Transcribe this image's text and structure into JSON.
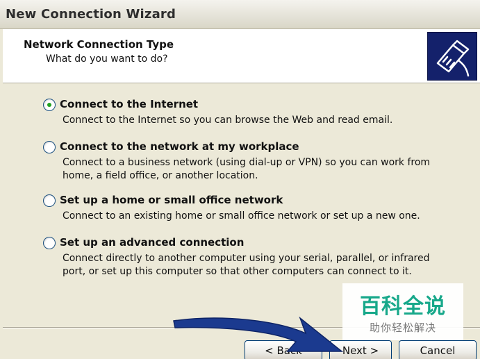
{
  "window": {
    "title": "New Connection Wizard"
  },
  "header": {
    "title": "Network Connection Type",
    "subtitle": "What do you want to do?",
    "icon": "network-cable-icon"
  },
  "options": [
    {
      "label": "Connect to the Internet",
      "description": "Connect to the Internet so you can browse the Web and read email.",
      "selected": true
    },
    {
      "label": "Connect to the network at my workplace",
      "description": "Connect to a business network (using dial-up or VPN) so you can work from home, a field office, or another location.",
      "selected": false
    },
    {
      "label": "Set up a home or small office network",
      "description": "Connect to an existing home or small office network or set up a new one.",
      "selected": false
    },
    {
      "label": "Set up an advanced connection",
      "description": "Connect directly to another computer using your serial, parallel, or infrared port, or set up this computer so that other computers can connect to it.",
      "selected": false
    }
  ],
  "buttons": {
    "back": "< Back",
    "next": "Next >",
    "cancel": "Cancel"
  },
  "watermark": {
    "title": "百科全说",
    "subtitle": "助你轻松解决"
  },
  "colors": {
    "accent_arrow": "#1b3a8f",
    "watermark_green": "#17a88a",
    "icon_bg": "#14216b"
  }
}
